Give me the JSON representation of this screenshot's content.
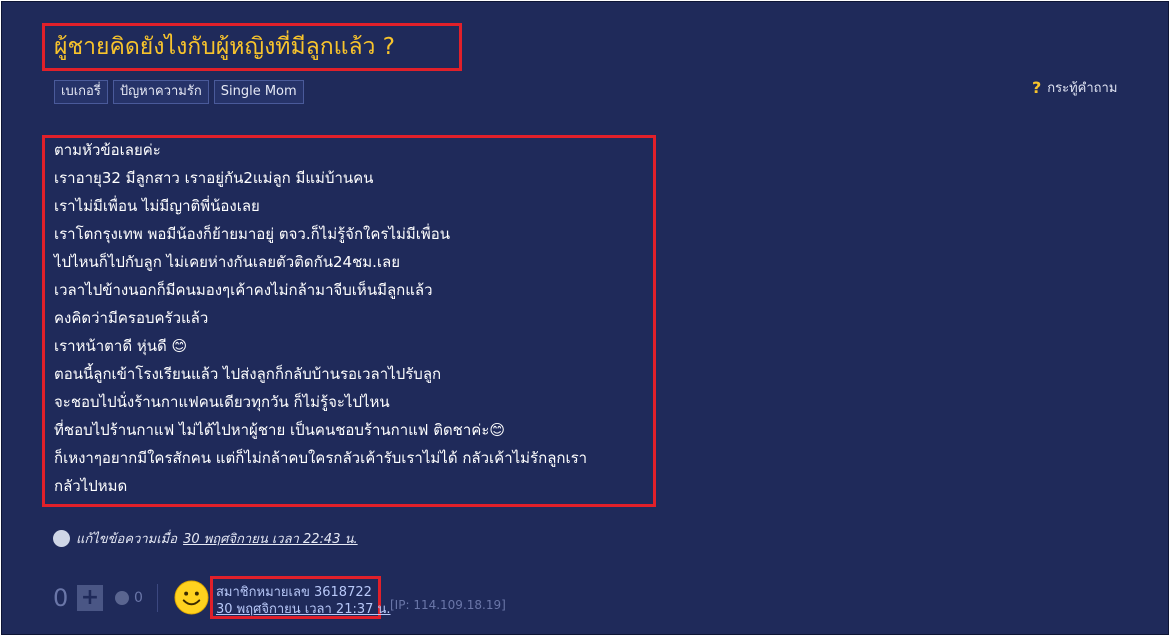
{
  "post": {
    "title": "ผู้ชายคิดยังไงกับผู้หญิงที่มีลูกแล้ว ?",
    "tags": [
      "เบเกอรี่",
      "ปัญหาความรัก",
      "Single Mom"
    ],
    "question_type": "กระทู้คำถาม",
    "body_lines": [
      "ตามหัวข้อเลยค่ะ",
      "เราอายุ32 มีลูกสาว เราอยู่กัน2แม่ลูก มีแม่บ้านคน",
      "เราไม่มีเพื่อน ไม่มีญาติพี่น้องเลย",
      "เราโตกรุงเทพ พอมีน้องก็ย้ายมาอยู่ ตจว.ก็ไม่รู้จักใครไม่มีเพื่อน",
      "ไปไหนก็ไปกับลูก ไม่เคยห่างกันเลยตัวติดกัน24ชม.เลย",
      "เวลาไปข้างนอกก็มีคนมองๆเค้าคงไม่กล้ามาจีบเห็นมีลูกแล้ว",
      "คงคิดว่ามีครอบครัวแล้ว",
      "เราหน้าตาดี หุ่นดี 😊",
      "ตอนนี้ลูกเข้าโรงเรียนแล้ว ไปส่งลูกก็กลับบ้านรอเวลาไปรับลูก",
      "จะชอบไปนั่งร้านกาแฟคนเดียวทุกวัน ก็ไม่รู้จะไปไหน",
      "ที่ชอบไปร้านกาแฟ ไม่ได้ไปหาผู้ชาย เป็นคนชอบร้านกาแฟ ติดชาค่ะ😊",
      "ก็เหงาๆอยากมีใครสักคน แต่ก็ไม่กล้าคบใครกลัวเค้ารับเราไม่ได้ กลัวเค้าไม่รักลูกเรา",
      "กลัวไปหมด"
    ],
    "edited_label": "แก้ไขข้อความเมื่อ",
    "edited_date": "30 พฤศจิกายน เวลา 22:43 น."
  },
  "footer": {
    "vote_count": "0",
    "emotion_count": "0",
    "member_label": "สมาชิกหมายเลข 3618722",
    "post_date": "30 พฤศจิกายน เวลา 21:37 น.",
    "ip": "[IP: 114.109.18.19]"
  },
  "icons": {
    "question": "question-mark-icon",
    "edit": "pencil-icon",
    "plus": "plus-icon",
    "emotion": "emotion-icon",
    "avatar": "smiley-avatar-icon"
  },
  "colors": {
    "background": "#1f2a5a",
    "title": "#f8c42c",
    "highlight": "#e0202a",
    "link": "#b8c8f8"
  }
}
